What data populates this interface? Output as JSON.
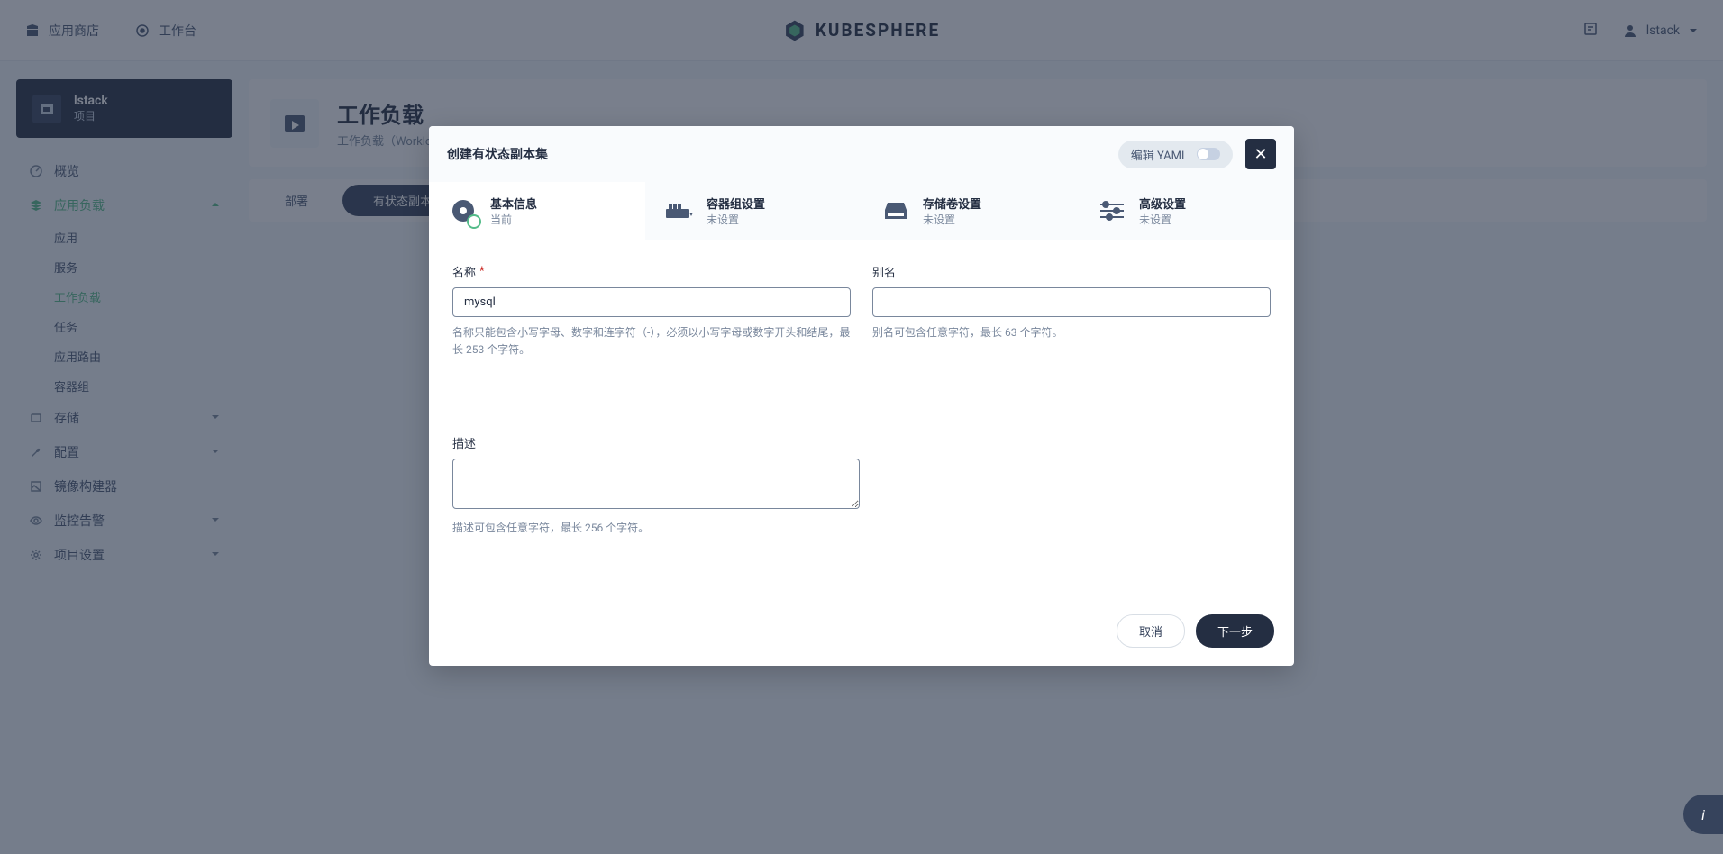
{
  "navbar": {
    "app_store": "应用商店",
    "workbench": "工作台",
    "brand": "KUBESPHERE",
    "user": "lstack"
  },
  "project": {
    "name": "lstack",
    "label": "项目"
  },
  "sidebar": {
    "overview": "概览",
    "app_workloads": "应用负载",
    "sub": {
      "apps": "应用",
      "services": "服务",
      "workloads": "工作负载",
      "jobs": "任务",
      "routes": "应用路由",
      "podgroups": "容器组"
    },
    "storage": "存储",
    "config": "配置",
    "image_builder": "镜像构建器",
    "monitor": "监控告警",
    "project_settings": "项目设置"
  },
  "page": {
    "title": "工作负载",
    "subtitle": "工作负载（Workload）",
    "tabs": {
      "deploy": "部署",
      "stateful": "有状态副本集"
    }
  },
  "modal": {
    "title": "创建有状态副本集",
    "yaml_label": "编辑 YAML",
    "steps": {
      "basic": {
        "title": "基本信息",
        "sub": "当前"
      },
      "pod": {
        "title": "容器组设置",
        "sub": "未设置"
      },
      "volume": {
        "title": "存储卷设置",
        "sub": "未设置"
      },
      "advanced": {
        "title": "高级设置",
        "sub": "未设置"
      }
    },
    "form": {
      "name_label": "名称",
      "name_value": "mysql",
      "name_hint": "名称只能包含小写字母、数字和连字符（-），必须以小写字母或数字开头和结尾，最长 253 个字符。",
      "alias_label": "别名",
      "alias_hint": "别名可包含任意字符，最长 63 个字符。",
      "desc_label": "描述",
      "desc_hint": "描述可包含任意字符，最长 256 个字符。"
    },
    "buttons": {
      "cancel": "取消",
      "next": "下一步"
    }
  }
}
